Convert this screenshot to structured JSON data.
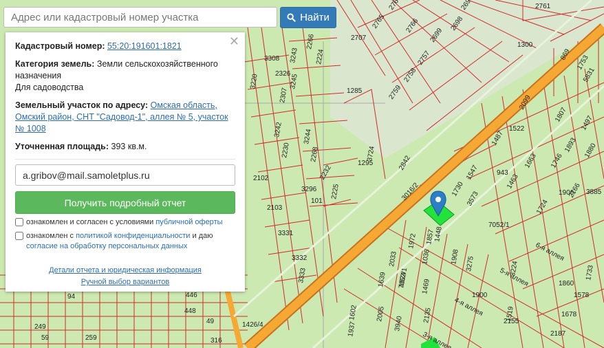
{
  "search": {
    "placeholder": "Адрес или кадастровый номер участка",
    "button_label": "Найти"
  },
  "panel": {
    "cadastral_label": "Кадастровый номер:",
    "cadastral_value": "55:20:191601:1821",
    "category_label": "Категория земель:",
    "category_value": "Земли сельскохозяйственного назначения",
    "purpose": "Для садоводства",
    "address_label": "Земельный участок по адресу:",
    "address_value": "Омская область, Омский район, СНТ \"Садовод-1\", аллея № 5, участок № 1008",
    "area_label": "Уточненная площадь:",
    "area_value": "393 кв.м.",
    "email_value": "a.gribov@mail.samoletplus.ru",
    "report_button": "Получить подробный отчет",
    "check1_text": "ознакомлен и согласен с условиями",
    "check1_link": "публичной оферты",
    "check2_text": "ознакомлен с",
    "check2_link": "политикой конфиденциальности",
    "check2_text2": "и даю",
    "check2_link2": "согласие на обработку персональных данных",
    "details_link": "Детали отчета и юридическая информация",
    "manual_link": "Ручной выбор вариантов"
  },
  "map_labels": [
    "3016/2",
    "2842",
    "2761",
    "2764",
    "2765",
    "2766",
    "2707",
    "2697",
    "2698",
    "2699",
    "2757",
    "2758",
    "2759",
    "1300",
    "869",
    "1753",
    "5831",
    "2099",
    "1522",
    "1807",
    "1487",
    "1893",
    "1497",
    "1880",
    "1663",
    "1746",
    "1463",
    "1724",
    "1906",
    "3885",
    "2166",
    "1730",
    "3573",
    "7052/1",
    "1547",
    "943",
    "3308",
    "2326",
    "3243",
    "3245",
    "2224",
    "2266",
    "3220",
    "2307",
    "3242",
    "3244",
    "2230",
    "2268",
    "3724",
    "3296",
    "2232",
    "2225",
    "2102",
    "2103",
    "101",
    "1295",
    "1285",
    "3331",
    "3332",
    "3333",
    "1972",
    "1857",
    "1448",
    "1908",
    "3275",
    "1900",
    "1860",
    "1733",
    "2033",
    "1036",
    "1639",
    "7052/1",
    "1469",
    "1578",
    "1678",
    "1602",
    "2005",
    "3940",
    "2135",
    "2155",
    "1519",
    "2187",
    "1426/4",
    "316",
    "446",
    "448",
    "259",
    "249",
    "59",
    "94",
    "1937",
    "49",
    "3224",
    "1624",
    "6-я аллея",
    "5-я аллея",
    "4-я аллея",
    "3-я аллея"
  ],
  "colors": {
    "map_bg": "#cde9b2",
    "road": "#f5a833",
    "parcel_line": "#d12b2b",
    "selected": "#22e23c",
    "pin": "#2c7fc4",
    "button_blue": "#337ab7",
    "button_green": "#5cb85c"
  }
}
